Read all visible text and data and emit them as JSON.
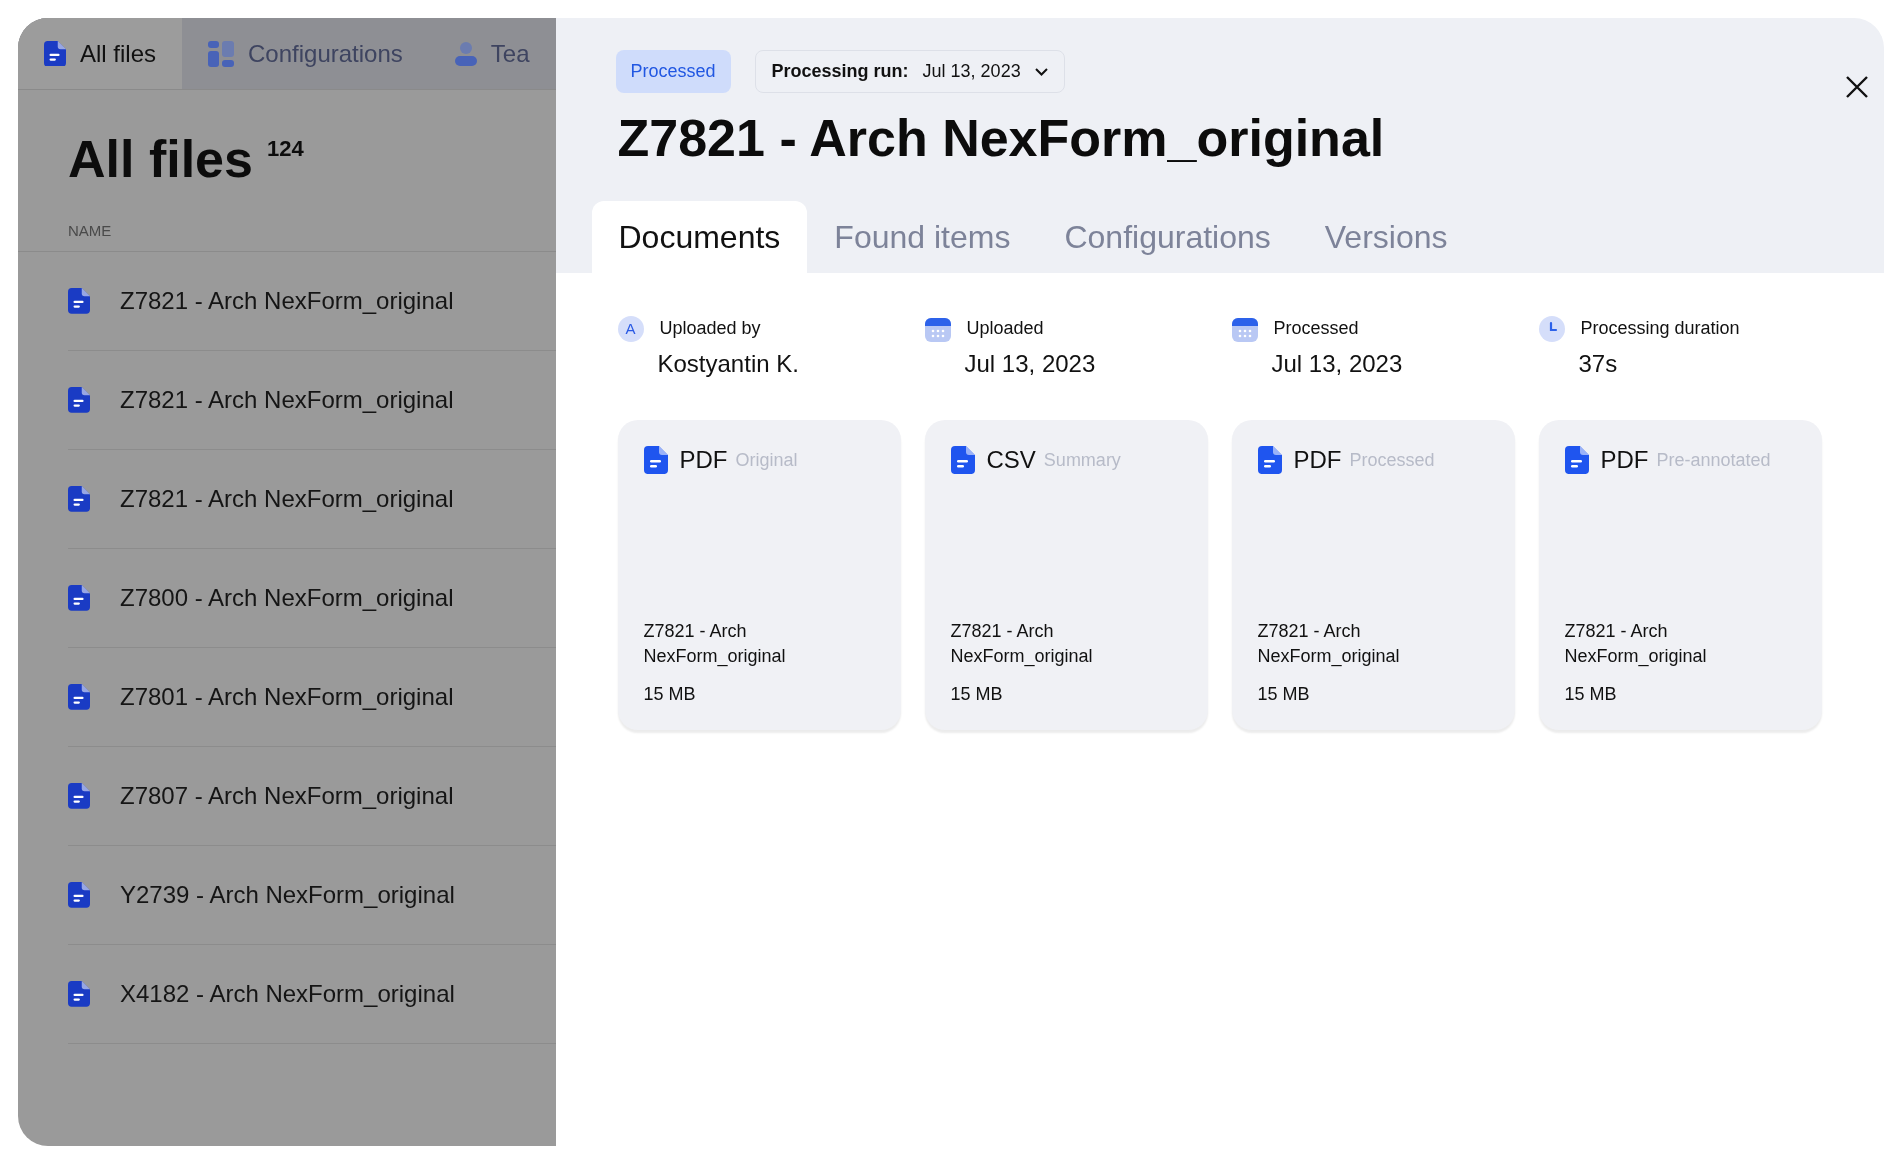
{
  "sidebar": {
    "tabs": [
      {
        "label": "All files",
        "kind": "file",
        "selected": true
      },
      {
        "label": "Configurations",
        "kind": "grid",
        "selected": false
      },
      {
        "label": "Tea",
        "kind": "person",
        "selected": false
      }
    ],
    "title": "All files",
    "count": "124",
    "column_header": "NAME",
    "files": [
      "Z7821 - Arch NexForm_original",
      "Z7821 - Arch NexForm_original",
      "Z7821 - Arch NexForm_original",
      "Z7800 - Arch NexForm_original",
      "Z7801 - Arch NexForm_original",
      "Z7807 - Arch NexForm_original",
      "Y2739 - Arch NexForm_original",
      "X4182 - Arch NexForm_original"
    ]
  },
  "drawer": {
    "status": "Processed",
    "run_label": "Processing run:",
    "run_value": "Jul 13, 2023",
    "title": "Z7821 - Arch NexForm_original",
    "tabs": [
      {
        "label": "Documents",
        "selected": true
      },
      {
        "label": "Found items",
        "selected": false
      },
      {
        "label": "Configurations",
        "selected": false
      },
      {
        "label": "Versions",
        "selected": false
      }
    ],
    "info": [
      {
        "kind": "avatar",
        "avatar_letter": "A",
        "label": "Uploaded by",
        "value": "Kostyantin K."
      },
      {
        "kind": "calendar",
        "label": "Uploaded",
        "value": "Jul 13, 2023"
      },
      {
        "kind": "calendar",
        "label": "Processed",
        "value": "Jul 13, 2023"
      },
      {
        "kind": "clock",
        "label": "Processing duration",
        "value": "37s"
      }
    ],
    "documents": [
      {
        "type": "PDF",
        "label": "Original",
        "name": "Z7821 - Arch NexForm_original",
        "size": "15 MB"
      },
      {
        "type": "CSV",
        "label": "Summary",
        "name": "Z7821 - Arch NexForm_original",
        "size": "15 MB"
      },
      {
        "type": "PDF",
        "label": "Processed",
        "name": "Z7821 - Arch NexForm_original",
        "size": "15 MB"
      },
      {
        "type": "PDF",
        "label": "Pre-annotated",
        "name": "Z7821 - Arch NexForm_original",
        "size": "15 MB"
      }
    ]
  }
}
